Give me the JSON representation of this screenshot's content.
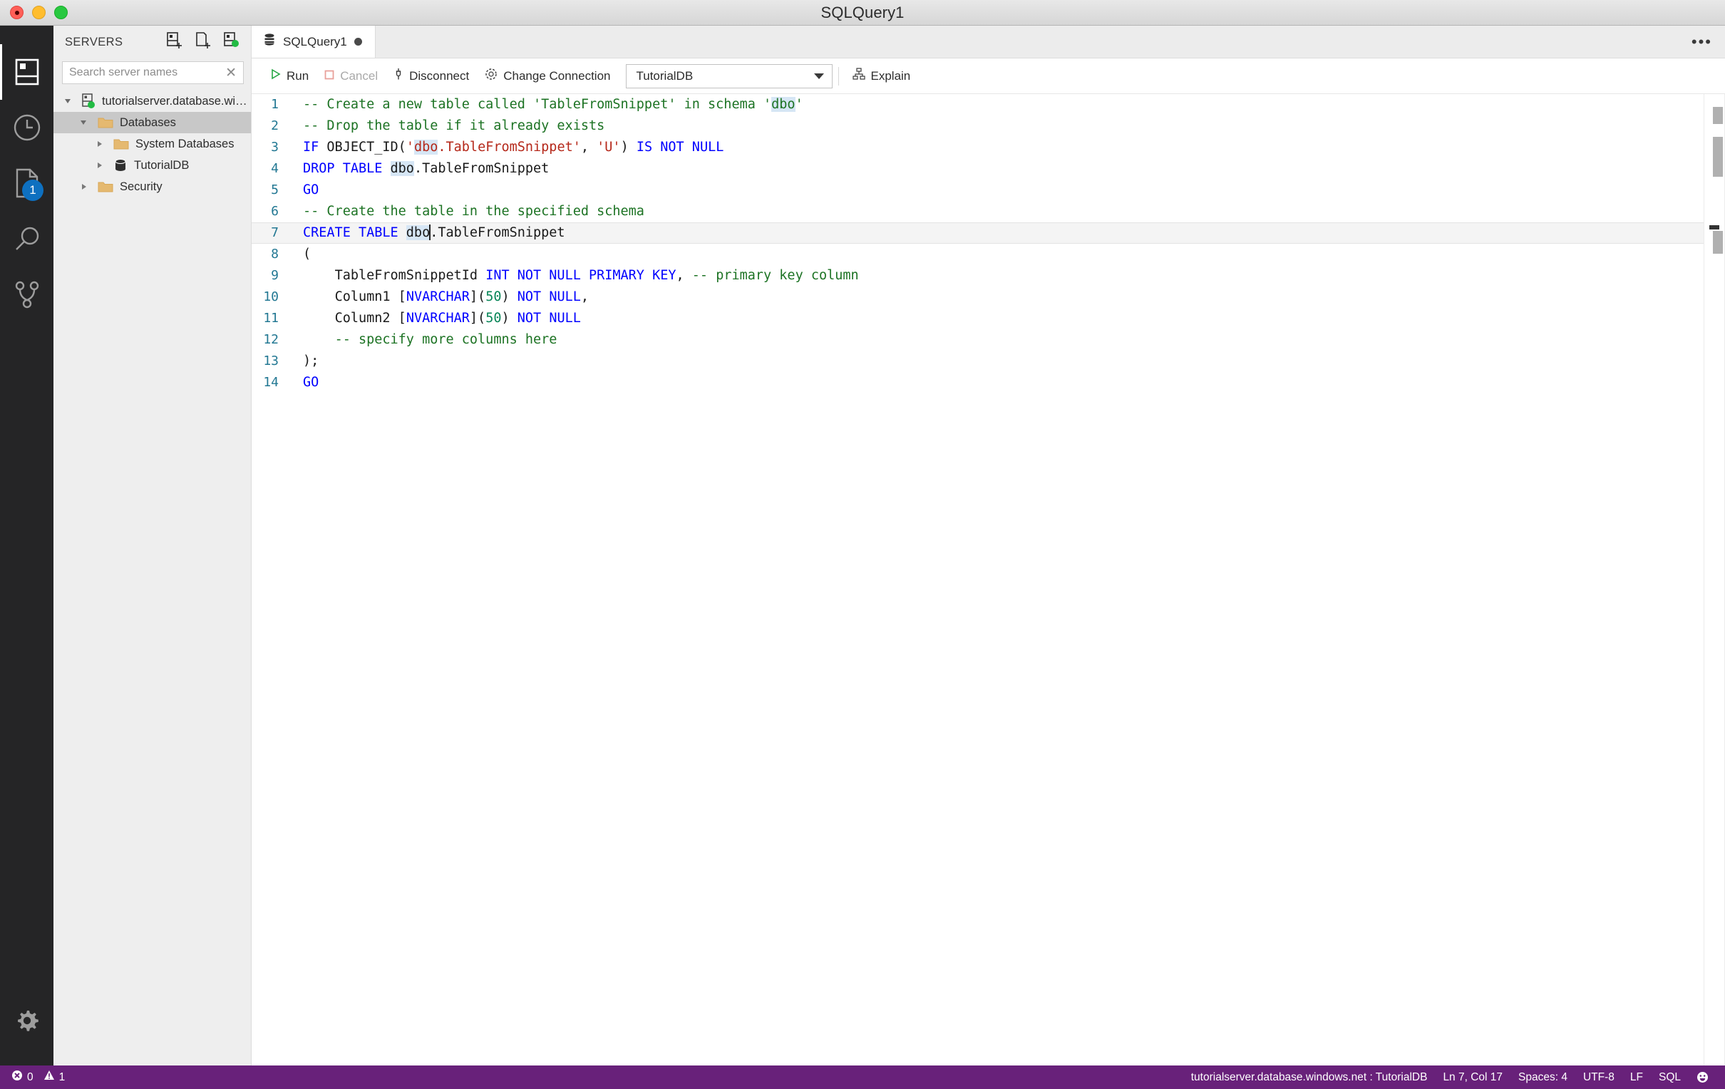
{
  "window": {
    "title": "SQLQuery1",
    "controls": [
      "close",
      "minimize",
      "zoom"
    ]
  },
  "activity_bar": {
    "items": [
      {
        "name": "servers",
        "icon": "servers-icon",
        "active": true,
        "badge": null
      },
      {
        "name": "history",
        "icon": "clock-icon",
        "active": false,
        "badge": null
      },
      {
        "name": "query-history",
        "icon": "file-icon",
        "active": false,
        "badge": "1"
      },
      {
        "name": "search",
        "icon": "search-icon",
        "active": false,
        "badge": null
      },
      {
        "name": "source-control",
        "icon": "source-control-icon",
        "active": false,
        "badge": null
      }
    ],
    "settings": {
      "name": "manage",
      "icon": "gear-icon"
    }
  },
  "sidebar": {
    "title": "SERVERS",
    "actions": [
      {
        "name": "new-connection",
        "icon": "add-server-icon"
      },
      {
        "name": "new-query",
        "icon": "new-query-icon"
      },
      {
        "name": "new-server-group",
        "icon": "server-group-icon"
      }
    ],
    "search": {
      "placeholder": "Search server names",
      "value": "",
      "clear_label": "✕"
    },
    "tree": [
      {
        "label": "tutorialserver.database.windows.n...",
        "icon": "server-icon",
        "level": 0,
        "expanded": true,
        "selected": false,
        "status": "connected"
      },
      {
        "label": "Databases",
        "icon": "folder-icon",
        "level": 1,
        "expanded": true,
        "selected": true
      },
      {
        "label": "System Databases",
        "icon": "folder-icon",
        "level": 2,
        "expanded": false,
        "selected": false
      },
      {
        "label": "TutorialDB",
        "icon": "database-icon",
        "level": 2,
        "expanded": false,
        "selected": false
      },
      {
        "label": "Security",
        "icon": "folder-icon",
        "level": 1,
        "expanded": false,
        "selected": false
      }
    ]
  },
  "tabs": {
    "items": [
      {
        "label": "SQLQuery1",
        "icon": "database-icon",
        "dirty": true,
        "active": true
      }
    ],
    "more_label": "•••"
  },
  "toolbar": {
    "run_label": "Run",
    "cancel_label": "Cancel",
    "disconnect_label": "Disconnect",
    "change_connection_label": "Change Connection",
    "database_value": "TutorialDB",
    "explain_label": "Explain",
    "cancel_disabled": true,
    "accent_run": "#26a644",
    "accent_cancel": "#e8a09a"
  },
  "editor": {
    "language": "SQL",
    "lines": [
      {
        "n": 1,
        "current": false,
        "tokens": [
          {
            "t": "-- Create a new table called 'TableFromSnippet' in schema '",
            "c": "cmt"
          },
          {
            "t": "dbo",
            "c": "cmt",
            "hl": true
          },
          {
            "t": "'",
            "c": "cmt"
          }
        ]
      },
      {
        "n": 2,
        "current": false,
        "tokens": [
          {
            "t": "-- Drop the table if it already exists",
            "c": "cmt"
          }
        ]
      },
      {
        "n": 3,
        "current": false,
        "tokens": [
          {
            "t": "IF",
            "c": "kw"
          },
          {
            "t": " OBJECT_ID(",
            "c": "plain"
          },
          {
            "t": "'",
            "c": "str"
          },
          {
            "t": "dbo",
            "c": "str",
            "hl": true
          },
          {
            "t": ".TableFromSnippet'",
            "c": "str"
          },
          {
            "t": ", ",
            "c": "plain"
          },
          {
            "t": "'U'",
            "c": "str"
          },
          {
            "t": ") ",
            "c": "plain"
          },
          {
            "t": "IS NOT NULL",
            "c": "kw"
          }
        ]
      },
      {
        "n": 4,
        "current": false,
        "tokens": [
          {
            "t": "DROP TABLE",
            "c": "kw"
          },
          {
            "t": " ",
            "c": "plain"
          },
          {
            "t": "dbo",
            "c": "plain",
            "hl": true
          },
          {
            "t": ".TableFromSnippet",
            "c": "plain"
          }
        ]
      },
      {
        "n": 5,
        "current": false,
        "tokens": [
          {
            "t": "GO",
            "c": "kw"
          }
        ]
      },
      {
        "n": 6,
        "current": false,
        "tokens": [
          {
            "t": "-- Create the table in the specified schema",
            "c": "cmt"
          }
        ]
      },
      {
        "n": 7,
        "current": true,
        "tokens": [
          {
            "t": "CREATE TABLE",
            "c": "kw"
          },
          {
            "t": " ",
            "c": "plain"
          },
          {
            "t": "dbo",
            "c": "plain",
            "hl": true
          },
          {
            "t": "|CARET|",
            "c": "caret"
          },
          {
            "t": ".TableFromSnippet",
            "c": "plain"
          }
        ]
      },
      {
        "n": 8,
        "current": false,
        "tokens": [
          {
            "t": "(",
            "c": "plain"
          }
        ]
      },
      {
        "n": 9,
        "current": false,
        "tokens": [
          {
            "t": "    ",
            "c": "guide"
          },
          {
            "t": "TableFromSnippetId ",
            "c": "plain"
          },
          {
            "t": "INT NOT NULL PRIMARY KEY",
            "c": "kw"
          },
          {
            "t": ", ",
            "c": "plain"
          },
          {
            "t": "-- primary key column",
            "c": "cmt"
          }
        ]
      },
      {
        "n": 10,
        "current": false,
        "tokens": [
          {
            "t": "    ",
            "c": "guide"
          },
          {
            "t": "Column1 [",
            "c": "plain"
          },
          {
            "t": "NVARCHAR",
            "c": "kw"
          },
          {
            "t": "](",
            "c": "plain"
          },
          {
            "t": "50",
            "c": "num"
          },
          {
            "t": ") ",
            "c": "plain"
          },
          {
            "t": "NOT NULL",
            "c": "kw"
          },
          {
            "t": ",",
            "c": "plain"
          }
        ]
      },
      {
        "n": 11,
        "current": false,
        "tokens": [
          {
            "t": "    ",
            "c": "guide"
          },
          {
            "t": "Column2 [",
            "c": "plain"
          },
          {
            "t": "NVARCHAR",
            "c": "kw"
          },
          {
            "t": "](",
            "c": "plain"
          },
          {
            "t": "50",
            "c": "num"
          },
          {
            "t": ") ",
            "c": "plain"
          },
          {
            "t": "NOT NULL",
            "c": "kw"
          }
        ]
      },
      {
        "n": 12,
        "current": false,
        "tokens": [
          {
            "t": "    ",
            "c": "guide"
          },
          {
            "t": "-- specify more columns here",
            "c": "cmt"
          }
        ]
      },
      {
        "n": 13,
        "current": false,
        "tokens": [
          {
            "t": ");",
            "c": "plain"
          }
        ]
      },
      {
        "n": 14,
        "current": false,
        "tokens": [
          {
            "t": "GO",
            "c": "kw"
          }
        ]
      }
    ]
  },
  "status_bar": {
    "errors_icon": "error-icon",
    "errors": "0",
    "warnings_icon": "warning-icon",
    "warnings": "1",
    "connection": "tutorialserver.database.windows.net : TutorialDB",
    "position": "Ln 7, Col 17",
    "indentation": "Spaces: 4",
    "encoding": "UTF-8",
    "eol": "LF",
    "language": "SQL",
    "feedback_icon": "smiley-icon",
    "background": "#68217a"
  }
}
